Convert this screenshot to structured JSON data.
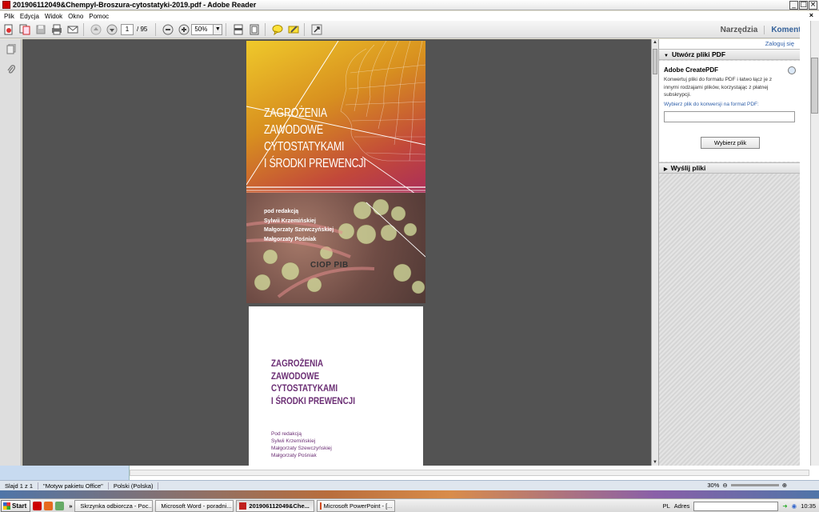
{
  "window": {
    "title": "201906112049&Chempyl-Broszura-cytostatyki-2019.pdf - Adobe Reader",
    "min": "_",
    "max": "□",
    "close": "×"
  },
  "menu": [
    "Plik",
    "Edycja",
    "Widok",
    "Okno",
    "Pomoc"
  ],
  "menu_close": "×",
  "toolbar": {
    "page_current": "1",
    "page_total": "/ 95",
    "zoom": "50%",
    "zoom_dd": "▼",
    "tools_label": "Narzędzia",
    "comment_label": "Komentarz"
  },
  "cover": {
    "title_lines": [
      "ZAGROŻENIA",
      "ZAWODOWE",
      "CYTOSTATYKAMI",
      "I ŚRODKI PREWENCJI"
    ],
    "credits": [
      "pod redakcją",
      "Sylwii Krzemińskiej",
      "Małgorzaty Szewczyńskiej",
      "Małgorzaty Pośniak"
    ],
    "publisher": "CIOP PIB"
  },
  "inner_page": {
    "title_lines": [
      "ZAGROŻENIA",
      "ZAWODOWE",
      "CYTOSTATYKAMI",
      "I ŚRODKI PREWENCJI"
    ],
    "credits": [
      "Pod redakcją",
      "Sylwii Krzemińskiej",
      "Małgorzaty Szewczyńskiej",
      "Małgorzaty Pośniak"
    ]
  },
  "right_panel": {
    "login": "Zaloguj się",
    "section1_title": "Utwórz pliki PDF",
    "section1_arrow": "▼",
    "service_title": "Adobe CreatePDF",
    "service_desc": "Konwertuj pliki do formatu PDF i łatwo łącz je z innymi rodzajami plików, korzystając z płatnej subskrypcji.",
    "choose_label": "Wybierz plik do konwersji na format PDF:",
    "choose_button": "Wybierz plik",
    "section2_title": "Wyślij pliki",
    "section2_arrow": "▶"
  },
  "statusbar": {
    "slide": "Slajd 1 z 1",
    "theme": "\"Motyw pakietu Office\"",
    "lang": "Polski (Polska)",
    "zoom": "30%"
  },
  "taskbar": {
    "start": "Start",
    "chevron": "»",
    "tasks": [
      {
        "label": "Skrzynka odbiorcza - Poc...",
        "active": false,
        "color": "#3c6fc0"
      },
      {
        "label": "Microsoft Word - poradni...",
        "active": false,
        "color": "#2b5fb5"
      },
      {
        "label": "201906112049&Che...",
        "active": true,
        "color": "#c0201e"
      },
      {
        "label": "Microsoft PowerPoint - [...",
        "active": false,
        "color": "#d04a1c"
      }
    ],
    "lang": "PL",
    "address_label": "Adres",
    "clock": "10:35"
  }
}
